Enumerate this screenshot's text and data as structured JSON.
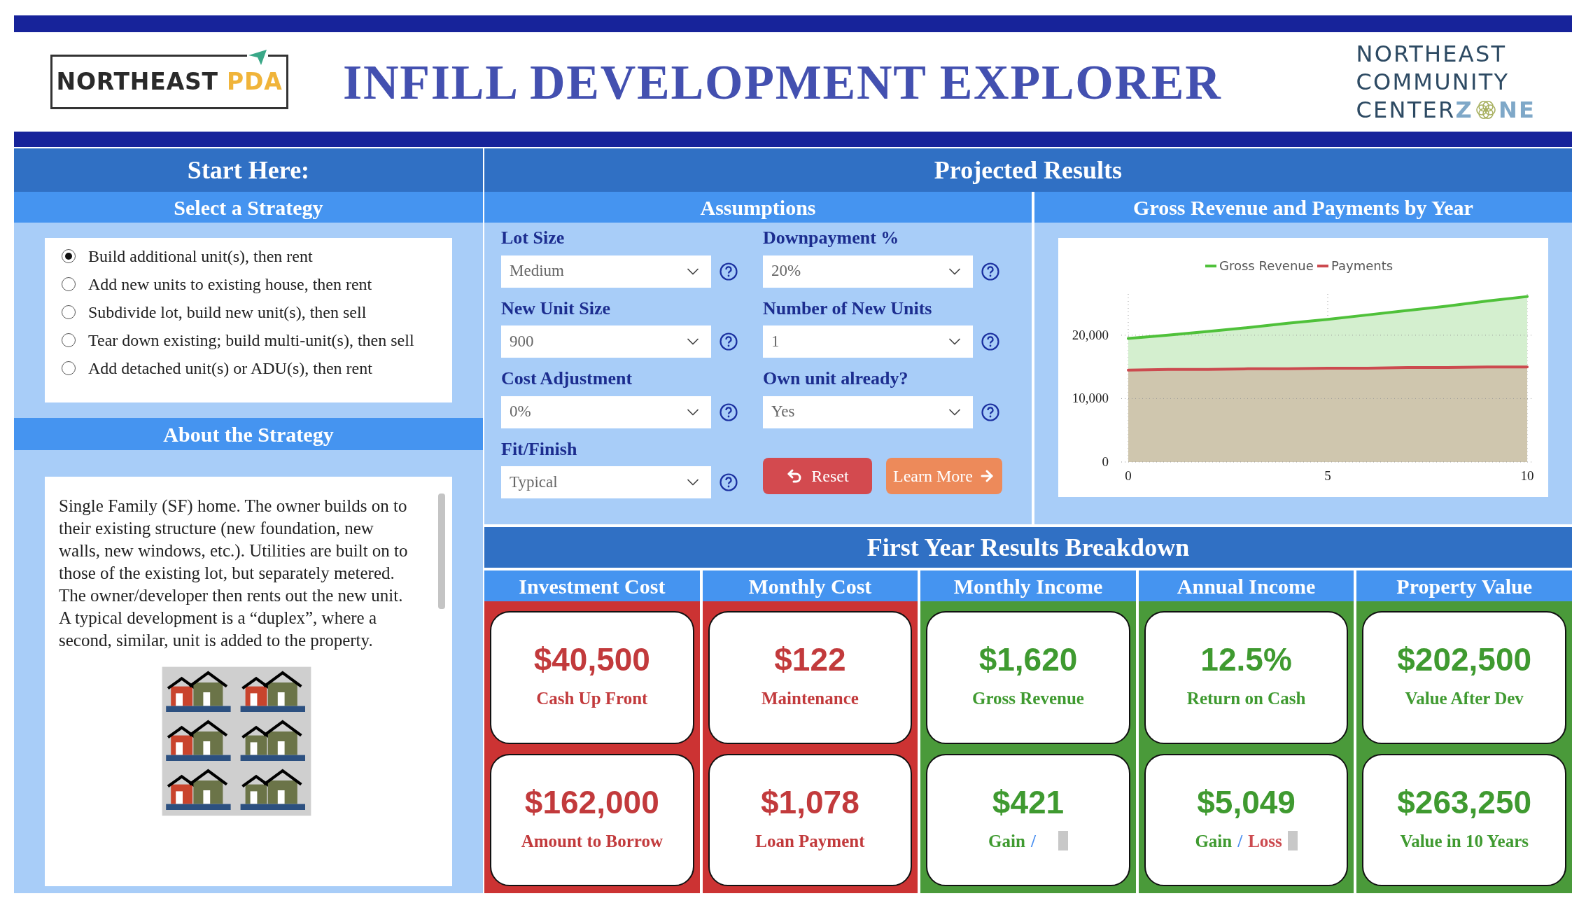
{
  "header": {
    "left_logo": {
      "word": "NORTHEAST",
      "accent": "PDA"
    },
    "title": "INFILL DEVELOPMENT EXPLORER",
    "right_logo": {
      "lines": [
        "NORTHEAST",
        "COMMUNITY"
      ],
      "last_prefix": "CENTER",
      "accent_start": "Z",
      "accent_end": "NE"
    }
  },
  "left": {
    "title": "Start Here:",
    "strategy_heading": "Select a Strategy",
    "strategies": [
      {
        "label": "Build additional unit(s), then rent",
        "selected": true
      },
      {
        "label": "Add new units to existing house, then rent",
        "selected": false
      },
      {
        "label": "Subdivide lot, build new unit(s), then sell",
        "selected": false
      },
      {
        "label": "Tear down existing; build multi-unit(s), then sell",
        "selected": false
      },
      {
        "label": "Add detached unit(s) or ADU(s), then rent",
        "selected": false
      }
    ],
    "about_heading": "About the Strategy",
    "about_text": "Single Family (SF) home. The owner builds on to their existing structure (new foundation, new walls, new windows, etc.). Utilities are built on to those of the existing lot, but separately metered. The owner/developer then rents out the new unit. A typical development is a “duplex”, where a second, similar, unit is added to the property."
  },
  "results": {
    "title": "Projected Results",
    "assumptions_heading": "Assumptions",
    "fields_left": [
      {
        "label": "Lot Size",
        "value": "Medium"
      },
      {
        "label": "New Unit Size",
        "value": "900"
      },
      {
        "label": "Cost Adjustment",
        "value": "0%"
      },
      {
        "label": "Fit/Finish",
        "value": "Typical"
      }
    ],
    "fields_right": [
      {
        "label": "Downpayment %",
        "value": "20%"
      },
      {
        "label": "Number of New Units",
        "value": "1"
      },
      {
        "label": "Own unit already?",
        "value": "Yes"
      }
    ],
    "buttons": [
      {
        "label": "Reset",
        "kind": "reset"
      },
      {
        "label": "Learn More",
        "kind": "more"
      }
    ],
    "chart_heading": "Gross Revenue and Payments by Year",
    "chart_data": {
      "type": "area",
      "x": [
        0,
        1,
        2,
        3,
        4,
        5,
        6,
        7,
        8,
        9,
        10
      ],
      "series": [
        {
          "name": "Gross Revenue",
          "color": "#4fc13a",
          "values": [
            19500,
            20000,
            20600,
            21200,
            21900,
            22500,
            23200,
            23900,
            24600,
            25400,
            26100
          ]
        },
        {
          "name": "Payments",
          "color": "#cc4a4f",
          "values": [
            14500,
            14600,
            14600,
            14700,
            14700,
            14800,
            14800,
            14900,
            14900,
            15000,
            15000
          ]
        }
      ],
      "xlim": [
        0,
        10
      ],
      "ylim": [
        0,
        26500
      ],
      "grid": true,
      "legend": true,
      "xticks": [
        0,
        5,
        10
      ],
      "yticks": [
        0,
        {
          "value": 10000,
          "label": "10,000"
        },
        {
          "value": 20000,
          "label": "20,000"
        }
      ]
    },
    "breakdown_heading": "First Year Results Breakdown",
    "columns": [
      {
        "title": "Investment Cost",
        "kind": "cost",
        "cards": [
          {
            "value": "$40,500",
            "label": [
              {
                "text": "Cash Up Front",
                "color": "#c23a3c"
              }
            ]
          },
          {
            "value": "$162,000",
            "label": [
              {
                "text": "Amount to Borrow",
                "color": "#c23a3c"
              }
            ]
          }
        ]
      },
      {
        "title": "Monthly Cost",
        "kind": "cost",
        "cards": [
          {
            "value": "$122",
            "label": [
              {
                "text": "Maintenance",
                "color": "#c23a3c"
              }
            ]
          },
          {
            "value": "$1,078",
            "label": [
              {
                "text": "Loan Payment",
                "color": "#c23a3c"
              }
            ]
          }
        ]
      },
      {
        "title": "Monthly Income",
        "kind": "income",
        "cards": [
          {
            "value": "$1,620",
            "label": [
              {
                "text": "Gross Revenue",
                "color": "#3f9a30"
              }
            ]
          },
          {
            "value": "$421",
            "label": [
              {
                "text": "Gain",
                "color": "#3f9a30"
              },
              {
                "text": "/",
                "color": "#4a8ff0"
              }
            ],
            "marker": true
          }
        ]
      },
      {
        "title": "Annual Income",
        "kind": "income",
        "cards": [
          {
            "value": "12.5%",
            "label": [
              {
                "text": "Return on Cash",
                "color": "#3f9a30"
              }
            ]
          },
          {
            "value": "$5,049",
            "label": [
              {
                "text": "Gain",
                "color": "#3f9a30"
              },
              {
                "text": "/",
                "color": "#4a8ff0"
              },
              {
                "text": "Loss",
                "color": "#cc4a4f"
              }
            ],
            "marker": true
          }
        ]
      },
      {
        "title": "Property Value",
        "kind": "income",
        "cards": [
          {
            "value": "$202,500",
            "label": [
              {
                "text": "Value After Dev",
                "color": "#3f9a30"
              }
            ]
          },
          {
            "value": "$263,250",
            "label": [
              {
                "text": "Value in 10 Years",
                "color": "#3f9a30"
              }
            ]
          }
        ]
      }
    ]
  }
}
